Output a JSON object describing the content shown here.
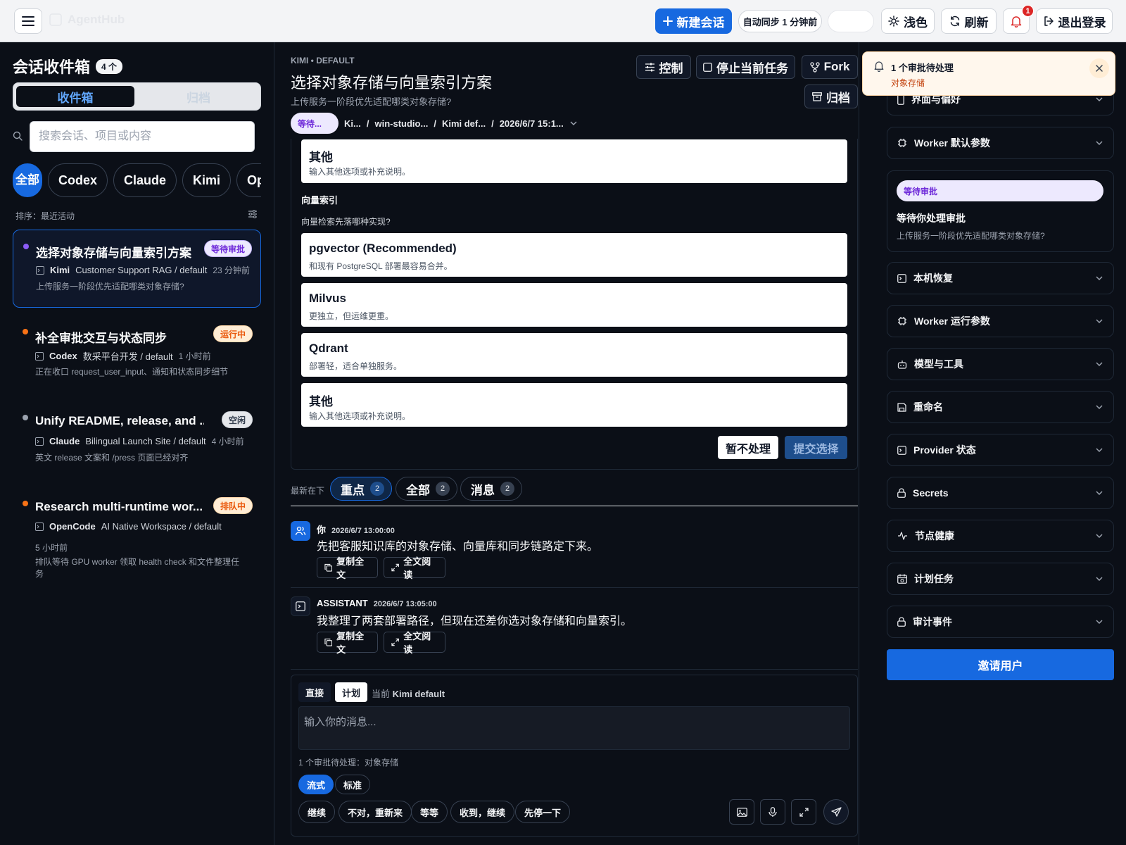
{
  "topbar": {
    "brand": "AgentHub",
    "new_session": "新建会话",
    "auto_sync": "自动同步 1 分钟前",
    "status_pill": "",
    "theme": "浅色",
    "refresh": "刷新",
    "notifications_count": "1",
    "logout": "退出登录"
  },
  "inbox": {
    "title": "会话收件箱",
    "count": "4 个",
    "tab_inbox": "收件箱",
    "tab_archive": "归档",
    "search_placeholder": "搜索会话、项目或内容",
    "filters": [
      "全部",
      "Codex",
      "Claude",
      "Kimi",
      "OpenCode"
    ],
    "sort_label": "排序：最近活动",
    "conversations": [
      {
        "title": "选择对象存储与向量索引方案",
        "status": "等待审批",
        "dot_color": "#8b5cf6",
        "agent": "Kimi",
        "project": "Customer Support RAG / default",
        "time": "23 分钟前",
        "preview": "上传服务一阶段优先适配哪类对象存储?"
      },
      {
        "title": "补全审批交互与状态同步",
        "status": "运行中",
        "dot_color": "#f97316",
        "agent": "Codex",
        "project": "数采平台开发 / default",
        "time": "1 小时前",
        "preview": "正在收口 request_user_input、通知和状态同步细节"
      },
      {
        "title": "Unify README, release, and ...",
        "status": "空闲",
        "dot_color": "#9ca3af",
        "agent": "Claude",
        "project": "Bilingual Launch Site / default",
        "time": "4 小时前",
        "preview": "英文 release 文案和 /press 页面已经对齐"
      },
      {
        "title": "Research multi-runtime wor...",
        "status": "排队中",
        "dot_color": "#f97316",
        "agent": "OpenCode",
        "project": "AI Native Workspace / default",
        "time": "5 小时前",
        "preview": "排队等待 GPU worker 领取 health check 和文件整理任务"
      }
    ]
  },
  "session": {
    "kicker": "KIMI • DEFAULT",
    "title": "选择对象存储与向量索引方案",
    "subtitle": "上传服务一阶段优先适配哪类对象存储?",
    "control": "控制",
    "stop": "停止当前任务",
    "fork": "Fork",
    "archive": "归档",
    "crumb_status": "等待...",
    "crumbs": [
      "Ki...",
      "win-studio...",
      "Kimi def...",
      "2026/6/7 15:1..."
    ]
  },
  "question": {
    "top_option": {
      "title": "其他",
      "desc": "输入其他选项或补充说明。"
    },
    "heading": "向量索引",
    "prompt": "向量检索先落哪种实现?",
    "options": [
      {
        "title": "pgvector (Recommended)",
        "desc": "和现有 PostgreSQL 部署最容易合并。"
      },
      {
        "title": "Milvus",
        "desc": "更独立，但运维更重。"
      },
      {
        "title": "Qdrant",
        "desc": "部署轻，适合单独服务。"
      },
      {
        "title": "其他",
        "desc": "输入其他选项或补充说明。"
      }
    ],
    "skip": "暂不处理",
    "submit": "提交选择"
  },
  "feed": {
    "order_label": "最新在下",
    "tabs": [
      {
        "label": "重点",
        "count": "2"
      },
      {
        "label": "全部",
        "count": "2"
      },
      {
        "label": "消息",
        "count": "2"
      }
    ],
    "messages": [
      {
        "who": "你",
        "time": "2026/6/7 13:00:00",
        "text": "先把客服知识库的对象存储、向量库和同步链路定下来。"
      },
      {
        "who": "ASSISTANT",
        "time": "2026/6/7 13:05:00",
        "text": "我整理了两套部署路径，但现在还差你选对象存储和向量索引。"
      }
    ],
    "copy_label": "复制全文",
    "read_label": "全文阅读"
  },
  "composer": {
    "mode_direct": "直接",
    "mode_plan": "计划",
    "current_prefix": "当前",
    "current_value": "Kimi default",
    "placeholder": "输入你的消息...",
    "pending": "1 个审批待处理：对象存储",
    "stream": "流式",
    "standard": "标准",
    "quick": [
      "继续",
      "不对，重新来",
      "等等",
      "收到，继续",
      "先停一下"
    ]
  },
  "sidebar": {
    "items": [
      {
        "label": "界面与偏好",
        "icon": "phone-icon"
      },
      {
        "label": "Worker 默认参数",
        "icon": "chip-icon"
      },
      {
        "label": "本机恢复",
        "icon": "terminal-icon"
      },
      {
        "label": "Worker 运行参数",
        "icon": "chip-icon"
      },
      {
        "label": "模型与工具",
        "icon": "bot-icon"
      },
      {
        "label": "重命名",
        "icon": "save-icon"
      },
      {
        "label": "Provider 状态",
        "icon": "terminal-icon"
      },
      {
        "label": "Secrets",
        "icon": "lock-icon"
      },
      {
        "label": "节点健康",
        "icon": "pulse-icon"
      },
      {
        "label": "计划任务",
        "icon": "calendar-icon"
      },
      {
        "label": "审计事件",
        "icon": "lock-icon"
      }
    ],
    "pending_badge": "等待审批",
    "pending_title": "等待你处理审批",
    "pending_desc": "上传服务一阶段优先适配哪类对象存储?",
    "invite": "邀请用户"
  },
  "toast": {
    "title": "1 个审批待处理",
    "desc": "对象存储"
  },
  "colors": {
    "accent": "#1769e0",
    "background": "#0b0f17",
    "pending_purple": "#6d28d9",
    "running_orange": "#ea580c"
  }
}
